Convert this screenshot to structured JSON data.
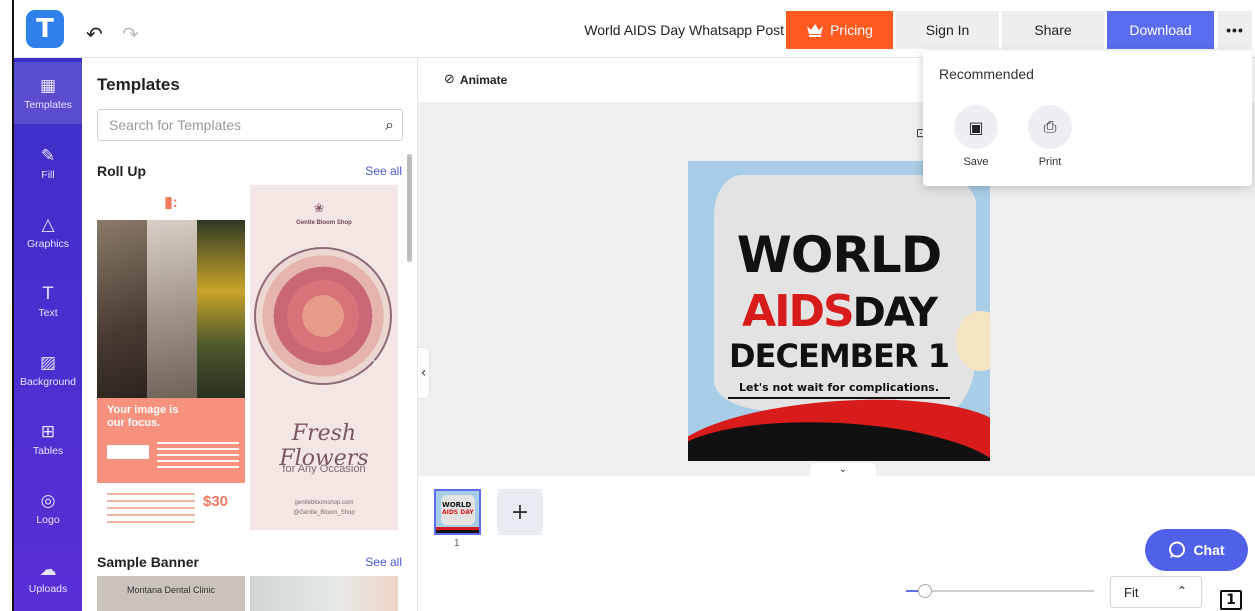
{
  "app": {
    "logo_letter": "T",
    "document_title": "World AIDS Day Whatsapp Post"
  },
  "toolbar": {
    "undo_glyph": "↶",
    "redo_glyph": "↷",
    "pricing_label": "Pricing",
    "pricing_icon": "crown-icon",
    "signin_label": "Sign In",
    "share_label": "Share",
    "download_label": "Download",
    "more_label": "•••"
  },
  "colors": {
    "brand_blue": "#5b6cf0",
    "pricing_orange": "#ff5a1f",
    "nav_purple": "#4a2fd0",
    "aids_red": "#d81b1b"
  },
  "leftnav": {
    "items": [
      {
        "label": "Templates",
        "icon": "templates-icon",
        "glyph": "▦"
      },
      {
        "label": "Fill",
        "icon": "fill-icon",
        "glyph": "✎"
      },
      {
        "label": "Graphics",
        "icon": "graphics-icon",
        "glyph": "△"
      },
      {
        "label": "Text",
        "icon": "text-icon",
        "glyph": "T"
      },
      {
        "label": "Background",
        "icon": "background-icon",
        "glyph": "▨"
      },
      {
        "label": "Tables",
        "icon": "tables-icon",
        "glyph": "⊞"
      },
      {
        "label": "Logo",
        "icon": "logo-icon",
        "glyph": "◎"
      },
      {
        "label": "Uploads",
        "icon": "uploads-icon",
        "glyph": "☁"
      }
    ]
  },
  "panel": {
    "title": "Templates",
    "search_placeholder": "Search for Templates",
    "sections": [
      {
        "title": "Roll Up",
        "see_all": "See all"
      },
      {
        "title": "Sample Banner",
        "see_all": "See all"
      }
    ]
  },
  "templates": {
    "rollup1": {
      "headline": "Your image is our focus.",
      "price": "$30"
    },
    "rollup2": {
      "shop_name": "Gentle Bloom Shop",
      "script_title": "Fresh Flowers",
      "subtitle": "for Any Occasion",
      "contact_line1": "gentlebloomshop.com",
      "contact_line2": "@Gentle_Bloom_Shop"
    },
    "banner1": {
      "text": "Montana Dental Clinic"
    }
  },
  "workspace": {
    "animate_label": "Animate",
    "canvas": {
      "line1": "WORLD",
      "line2a": "AIDS",
      "line2b": "DAY",
      "line3": "DECEMBER 1",
      "tagline": "Let's not wait for complications."
    },
    "thumb": {
      "line1": "WORLD",
      "line2": "AIDS DAY"
    },
    "page_number": "1",
    "add_page_glyph": "+",
    "zoom": {
      "fit_label": "Fit",
      "level_fraction": 0.1
    },
    "pages_icon_glyph": "1"
  },
  "chat": {
    "label": "Chat"
  },
  "dropdown": {
    "title": "Recommended",
    "items": [
      {
        "label": "Save",
        "icon": "save-icon",
        "glyph": "▣"
      },
      {
        "label": "Print",
        "icon": "print-icon",
        "glyph": "⎙"
      }
    ]
  }
}
